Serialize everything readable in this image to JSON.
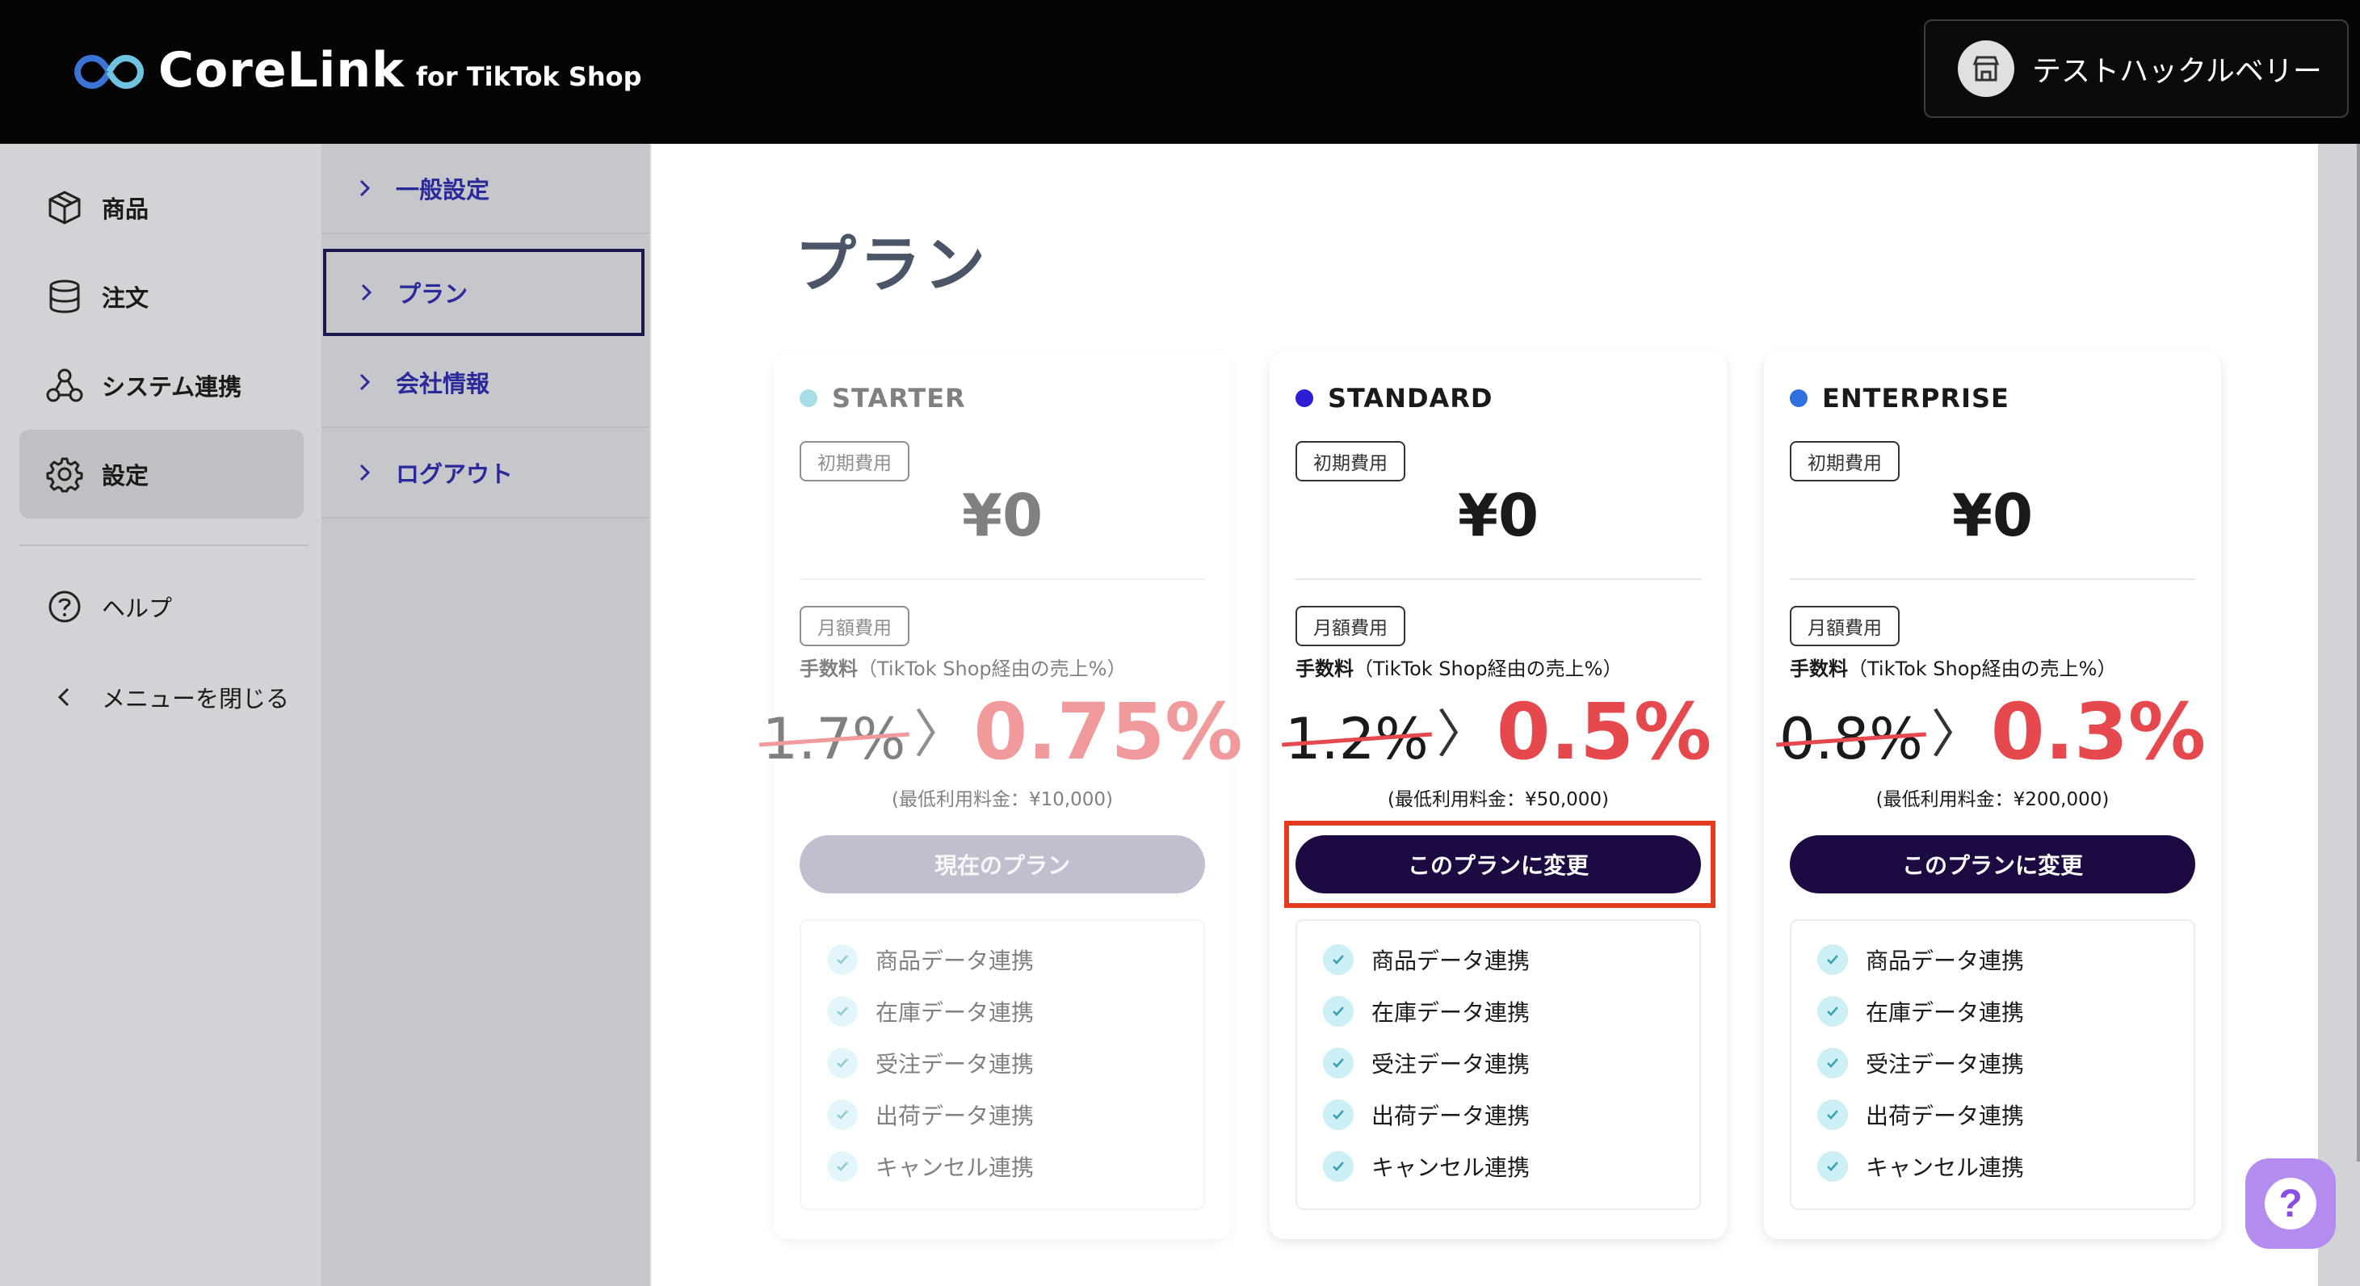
{
  "header": {
    "brand_name": "CoreLink",
    "brand_sub": "for TikTok Shop",
    "store_name": "テストハックルベリー"
  },
  "sidebar": {
    "items": [
      {
        "label": "商品",
        "icon": "box-icon"
      },
      {
        "label": "注文",
        "icon": "database-icon"
      },
      {
        "label": "システム連携",
        "icon": "network-icon"
      },
      {
        "label": "設定",
        "icon": "gear-icon",
        "active": true
      }
    ],
    "help_label": "ヘルプ",
    "close_menu_label": "メニューを閉じる"
  },
  "subnav": {
    "items": [
      {
        "label": "一般設定"
      },
      {
        "label": "プラン",
        "active": true
      },
      {
        "label": "会社情報"
      },
      {
        "label": "ログアウト"
      }
    ]
  },
  "main": {
    "title": "プラン",
    "plans": [
      {
        "name": "STARTER",
        "dot_color": "#5ec3d4",
        "initial_fee_tag": "初期費用",
        "initial_price": "¥0",
        "monthly_fee_tag": "月額費用",
        "fee_label_bold": "手数料",
        "fee_label_rest": "（TikTok Shop経由の売上%）",
        "old_rate": "1.7%",
        "separator": "〉",
        "new_rate": "0.75%",
        "min_fee": "(最低利用料金：¥10,000)",
        "button": "現在のプラン",
        "features": [
          "商品データ連携",
          "在庫データ連携",
          "受注データ連携",
          "出荷データ連携",
          "キャンセル連携"
        ]
      },
      {
        "name": "STANDARD",
        "dot_color": "#2d1ed6",
        "initial_fee_tag": "初期費用",
        "initial_price": "¥0",
        "monthly_fee_tag": "月額費用",
        "fee_label_bold": "手数料",
        "fee_label_rest": "（TikTok Shop経由の売上%）",
        "old_rate": "1.2%",
        "separator": "〉",
        "new_rate": "0.5%",
        "min_fee": "(最低利用料金：¥50,000)",
        "button": "このプランに変更",
        "features": [
          "商品データ連携",
          "在庫データ連携",
          "受注データ連携",
          "出荷データ連携",
          "キャンセル連携"
        ]
      },
      {
        "name": "ENTERPRISE",
        "dot_color": "#2f6fe0",
        "initial_fee_tag": "初期費用",
        "initial_price": "¥0",
        "monthly_fee_tag": "月額費用",
        "fee_label_bold": "手数料",
        "fee_label_rest": "（TikTok Shop経由の売上%）",
        "old_rate": "0.8%",
        "separator": "〉",
        "new_rate": "0.3%",
        "min_fee": "(最低利用料金：¥200,000)",
        "button": "このプランに変更",
        "features": [
          "商品データ連携",
          "在庫データ連携",
          "受注データ連携",
          "出荷データ連携",
          "キャンセル連携"
        ]
      }
    ]
  },
  "chat": {
    "glyph": "?"
  },
  "colors": {
    "accent": "#1d0a42",
    "rate_red": "#e5484d",
    "highlight": "#e53b21",
    "subnav_text": "#2a2a9a"
  }
}
